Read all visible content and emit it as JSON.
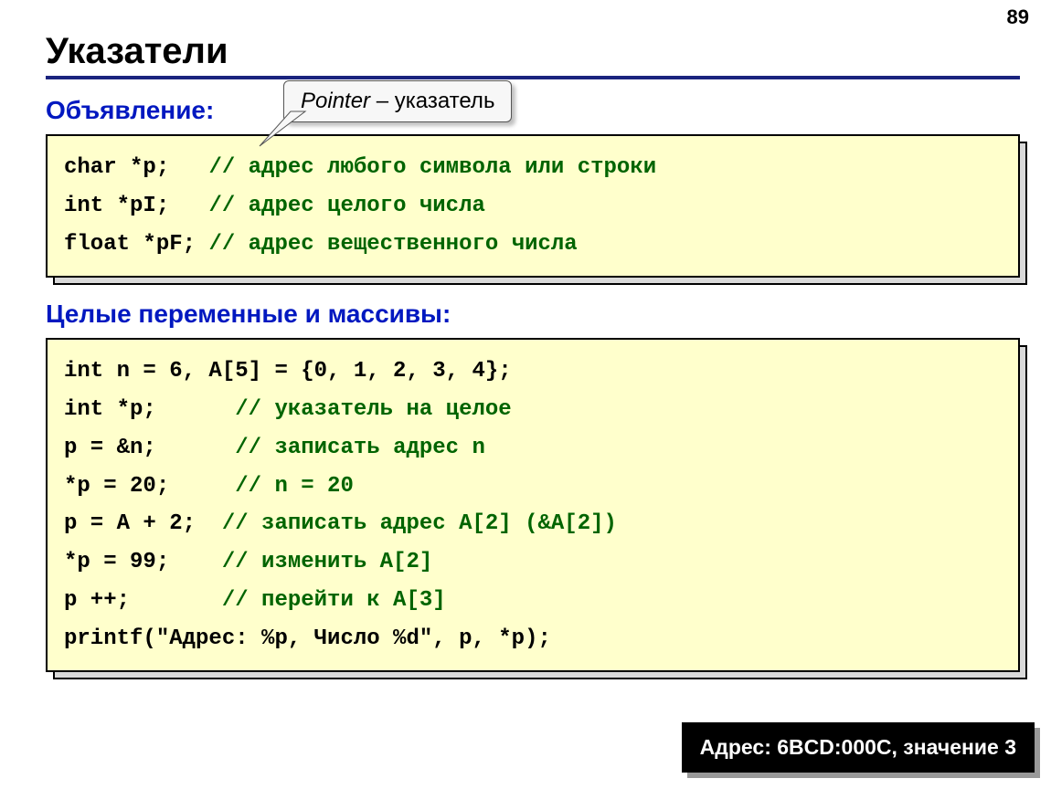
{
  "page_number": "89",
  "title": "Указатели",
  "callout_italic": "Pointer",
  "callout_rest": " – указатель",
  "subhead1": "Объявление:",
  "code1": {
    "l1a": "char *p;   ",
    "l1b": "// адрес любого символа или строки",
    "l2a": "int *pI;   ",
    "l2b": "// адрес целого числа",
    "l3a": "float *pF; ",
    "l3b": "// адрес вещественного числа"
  },
  "subhead2": "Целые переменные и массивы:",
  "code2": {
    "l1": "int n = 6, A[5] = {0, 1, 2, 3, 4};",
    "l2a": "int *p;      ",
    "l2b": "// указатель на целое",
    "l3a": "p = &n;      ",
    "l3b": "// записать адрес n",
    "l4a": "*p = 20;     ",
    "l4b": "// n = 20",
    "l5a": "p = A + 2;  ",
    "l5b": "// записать адрес A[2] (&A[2])",
    "l6a": "*p = 99;    ",
    "l6b": "// изменить A[2]",
    "l7a": "p ++;       ",
    "l7b": "// перейти к A[3]",
    "l8": "printf(\"Адрес: %p, Число %d\", p, *p);"
  },
  "output_label": "Адрес: 6BCD:000C, значение 3"
}
